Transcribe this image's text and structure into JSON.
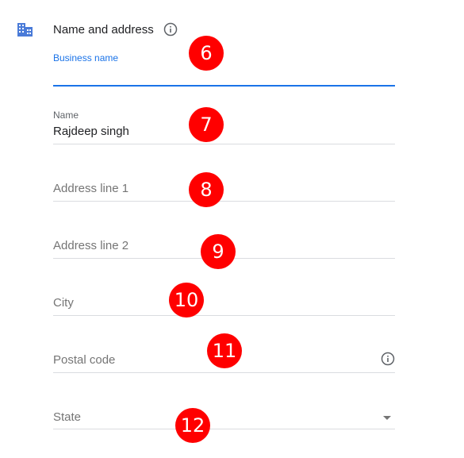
{
  "section": {
    "icon": "building-icon",
    "title": "Name and address",
    "info_icon": "info-icon"
  },
  "fields": {
    "business_name": {
      "label": "Business name",
      "value": ""
    },
    "name": {
      "label": "Name",
      "value": "Rajdeep singh"
    },
    "address_line_1": {
      "placeholder": "Address line 1"
    },
    "address_line_2": {
      "placeholder": "Address line 2"
    },
    "city": {
      "placeholder": "City"
    },
    "postal_code": {
      "placeholder": "Postal code",
      "info_icon": "info-icon"
    },
    "state": {
      "placeholder": "State",
      "dropdown_icon": "caret-down-icon"
    }
  },
  "badges": [
    "6",
    "7",
    "8",
    "9",
    "10",
    "11",
    "12"
  ],
  "colors": {
    "accent": "#1a73e8",
    "badge": "#ff0000",
    "icon": "#4a7bd8",
    "divider": "#dadce0"
  }
}
